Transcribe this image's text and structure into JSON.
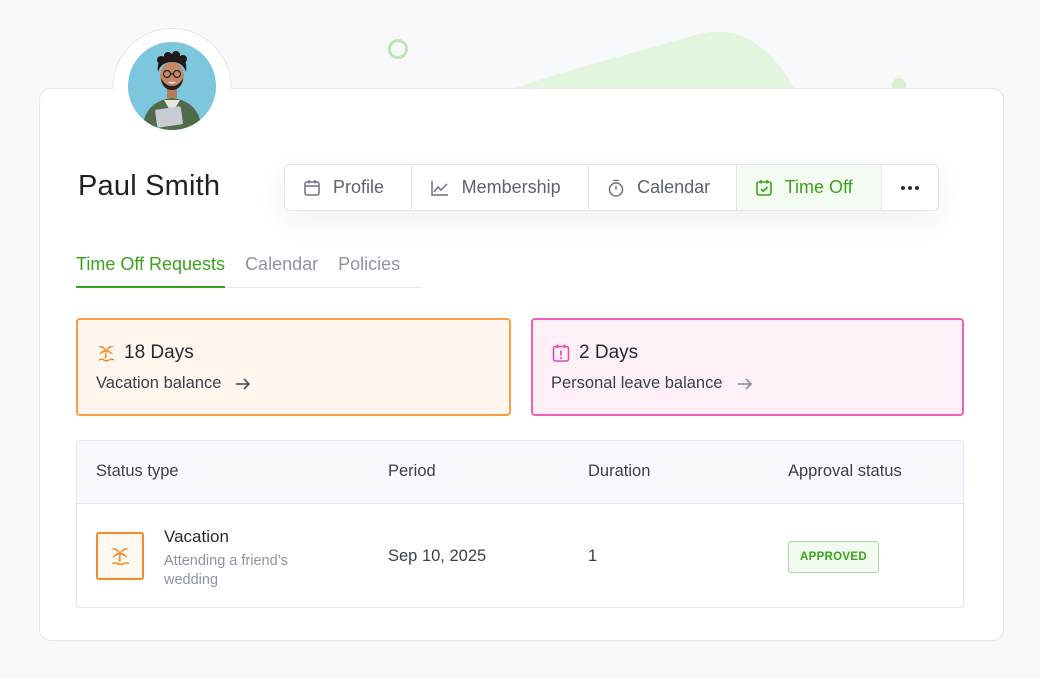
{
  "user": {
    "name": "Paul Smith"
  },
  "nav": {
    "profile": "Profile",
    "membership": "Membership",
    "calendar": "Calendar",
    "time_off": "Time Off",
    "active": "Time Off"
  },
  "subtabs": {
    "requests": "Time Off Requests",
    "calendar": "Calendar",
    "policies": "Policies",
    "active": "Time Off Requests"
  },
  "balances": {
    "vacation": {
      "days": "18 Days",
      "label": "Vacation balance"
    },
    "personal": {
      "days": "2 Days",
      "label": "Personal leave balance"
    }
  },
  "table": {
    "headers": [
      "Status type",
      "Period",
      "Duration",
      "Approval status"
    ],
    "rows": [
      {
        "type": "Vacation",
        "description": "Attending a friend’s wedding",
        "period": "Sep 10, 2025",
        "duration": "1",
        "status": "APPROVED"
      }
    ]
  },
  "colors": {
    "accent_green": "#3aa21b",
    "vacation_orange": "#f7a043",
    "personal_pink": "#ee5fb6"
  },
  "icons": {
    "profile": "calendar-icon",
    "membership": "line-chart-icon",
    "calendar": "stopwatch-icon",
    "time_off": "calendar-check-icon",
    "more": "more-horizontal-icon",
    "vacation": "palm-tree-icon",
    "personal": "alert-calendar-icon"
  }
}
